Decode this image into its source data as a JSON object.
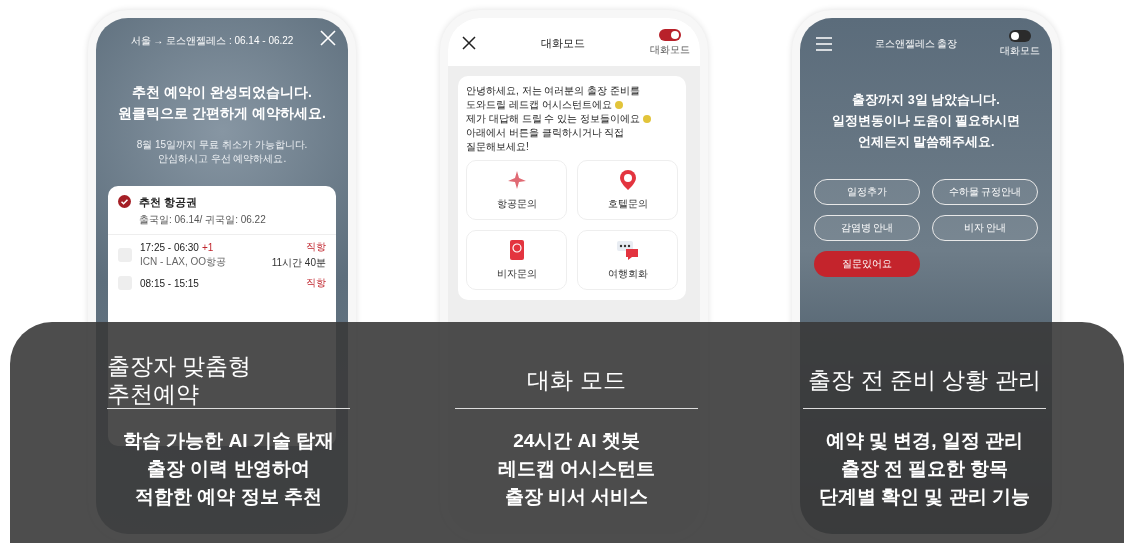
{
  "booking_screen": {
    "route": "서울 → 로스앤젤레스 : 06.14 - 06.22",
    "headline": [
      "추천 예약이 완성되었습니다.",
      "원클릭으로 간편하게 예약하세요."
    ],
    "notice": [
      "8월 15일까지 무료 취소가 가능합니다.",
      "안심하시고 우선 예약하세요."
    ],
    "card": {
      "title": "추천 항공권",
      "dates": "출국일: 06.14/ 귀국일: 06.22"
    },
    "flights": [
      {
        "time": "17:25 - 06:30",
        "next_day": "+1",
        "route": "ICN - LAX, OO항공",
        "type": "직항",
        "duration": "11시간 40분"
      },
      {
        "time": "08:15 - 15:15",
        "type": "직항"
      }
    ]
  },
  "chat_screen": {
    "title": "대화모드",
    "toggle": {
      "label": "대화모드",
      "on": true
    },
    "message": [
      {
        "text": "안녕하세요, 저는 여러분의 출장 준비를",
        "emoji": false
      },
      {
        "text": "도와드릴 레드캡 어시스턴트에요",
        "emoji": true
      },
      {
        "text": "제가 대답해 드릴 수 있는 정보들이에요",
        "emoji": true
      },
      {
        "text": "아래에서 버튼을 클릭하시거나 직접",
        "emoji": false
      },
      {
        "text": "질문해보세요!",
        "emoji": false
      }
    ],
    "quick_buttons": [
      {
        "label": "항공문의",
        "kind": "flight"
      },
      {
        "label": "호텔문의",
        "kind": "hotel"
      },
      {
        "label": "비자문의",
        "kind": "visa"
      },
      {
        "label": "여행회화",
        "kind": "talk"
      }
    ]
  },
  "trip_screen": {
    "title": "로스앤젤레스 출장",
    "toggle": {
      "label": "대화모드",
      "on": false
    },
    "headline": [
      "출장까지 3일 남았습니다.",
      "일정변동이나 도움이 필요하시면",
      "언제든지 말씀해주세요."
    ],
    "chips": [
      {
        "label": "일정추가",
        "kind": "outline"
      },
      {
        "label": "수하물 규정안내",
        "kind": "outline"
      },
      {
        "label": "감염병 안내",
        "kind": "outline"
      },
      {
        "label": "비자 안내",
        "kind": "outline"
      },
      {
        "label": "질문있어요",
        "kind": "primary"
      }
    ]
  },
  "features": [
    {
      "title": "출장자 맞춤형 추천예약",
      "description": [
        "학습 가능한 AI 기술 탑재",
        "출장 이력 반영하여",
        "적합한 예약 정보 추천"
      ]
    },
    {
      "title": "대화 모드",
      "description": [
        "24시간 AI 챗봇",
        "레드캡 어시스턴트",
        "출장 비서 서비스"
      ]
    },
    {
      "title": "출장 전 준비 상황 관리",
      "description": [
        "예약 및 변경, 일정 관리",
        "출장 전 필요한 항목",
        "단계별 확인 및 관리 기능"
      ]
    }
  ]
}
